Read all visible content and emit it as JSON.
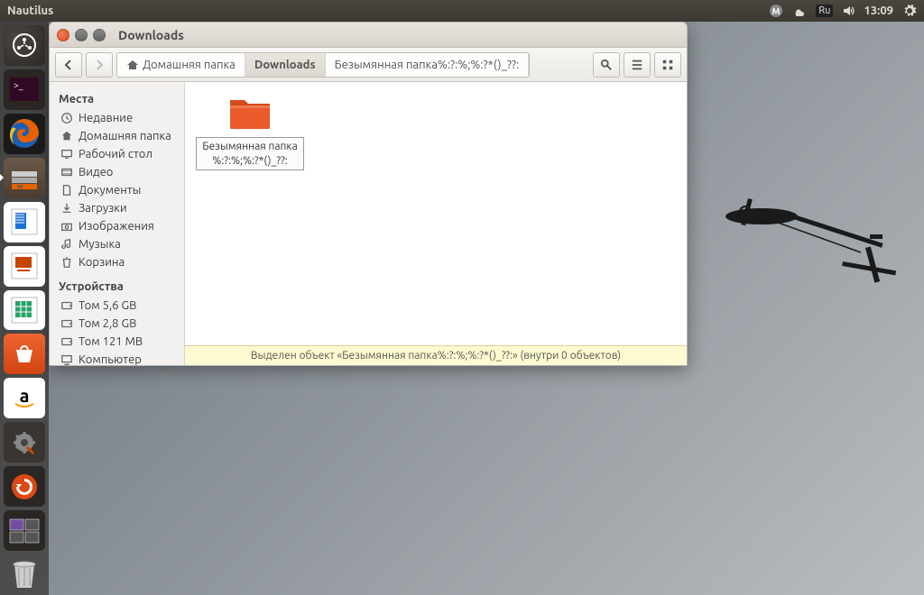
{
  "menubar": {
    "app": "Nautilus",
    "lang": "Ru",
    "time": "13:09"
  },
  "launcher": {
    "items": [
      {
        "name": "dash"
      },
      {
        "name": "terminal"
      },
      {
        "name": "firefox"
      },
      {
        "name": "files"
      },
      {
        "name": "writer"
      },
      {
        "name": "impress"
      },
      {
        "name": "calc"
      },
      {
        "name": "software-center"
      },
      {
        "name": "amazon"
      },
      {
        "name": "system-settings"
      },
      {
        "name": "software-updater"
      },
      {
        "name": "workspace-switcher"
      },
      {
        "name": "trash"
      }
    ]
  },
  "window": {
    "title": "Downloads",
    "path": {
      "home": "Домашняя папка",
      "current": "Downloads",
      "next": "Безымянная папка%:?:%;%:?*()_??:"
    },
    "sidebar": {
      "places_title": "Места",
      "devices_title": "Устройства",
      "places": [
        "Недавние",
        "Домашняя папка",
        "Рабочий стол",
        "Видео",
        "Документы",
        "Загрузки",
        "Изображения",
        "Музыка",
        "Корзина"
      ],
      "devices": [
        "Том 5,6 GB",
        "Том 2,8 GB",
        "Том 121 MB",
        "Компьютер"
      ]
    },
    "folder": {
      "line1": "Безымянная папка",
      "line2": "%:?:%;%:?*()_??:"
    },
    "status": "Выделен объект «Безымянная папка%:?:%;%:?*()_??:» (внутри 0 объектов)"
  }
}
